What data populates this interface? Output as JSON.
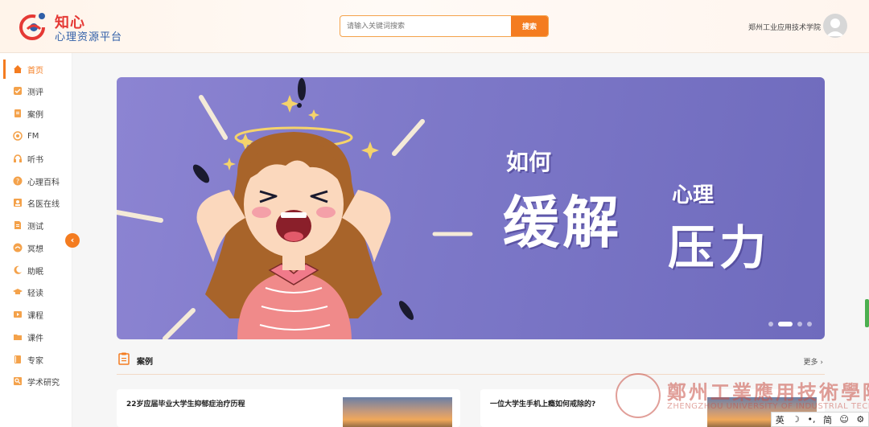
{
  "brand": {
    "title": "知心",
    "subtitle": "心理资源平台"
  },
  "search": {
    "placeholder": "请输入关键词搜索",
    "button_label": "搜索"
  },
  "user": {
    "school": "郑州工业应用技术学院"
  },
  "sidebar": {
    "items": [
      {
        "label": "首页",
        "icon": "home-icon",
        "active": true
      },
      {
        "label": "测评",
        "icon": "check-icon"
      },
      {
        "label": "案例",
        "icon": "clipboard-icon"
      },
      {
        "label": "FM",
        "icon": "radio-icon"
      },
      {
        "label": "听书",
        "icon": "headphones-icon"
      },
      {
        "label": "心理百科",
        "icon": "question-icon"
      },
      {
        "label": "名医在线",
        "icon": "doctor-icon"
      },
      {
        "label": "测试",
        "icon": "document-icon"
      },
      {
        "label": "冥想",
        "icon": "meditation-icon"
      },
      {
        "label": "助眠",
        "icon": "moon-icon"
      },
      {
        "label": "轻读",
        "icon": "graduation-icon"
      },
      {
        "label": "课程",
        "icon": "course-icon"
      },
      {
        "label": "课件",
        "icon": "folder-icon"
      },
      {
        "label": "专家",
        "icon": "book-icon"
      },
      {
        "label": "学术研究",
        "icon": "research-icon"
      }
    ],
    "collapse_symbol": "‹"
  },
  "banner": {
    "line1": "如何",
    "line2a": "缓解",
    "line2b": "心理",
    "line3": "压力",
    "slides": 4,
    "active_slide": 2
  },
  "section": {
    "title": "案例",
    "more_label": "更多 ›"
  },
  "cards": [
    {
      "title": "22岁应届毕业大学生抑郁症治疗历程"
    },
    {
      "title": "一位大学生手机上瘾如何戒除的?"
    }
  ],
  "watermark": {
    "cn": "鄭州工業應用技術學院",
    "en": "ZHENGZHOU UNIVERSITY OF INDUSTRIAL TECHNOLOGY"
  },
  "ime": {
    "items": [
      "英",
      "☽",
      "•,",
      "简",
      "☺",
      "⚙"
    ]
  },
  "colors": {
    "accent": "#f47c20",
    "brand_red": "#e53935",
    "brand_blue": "#2f5fa8",
    "banner_bg": "#7d78c8"
  }
}
